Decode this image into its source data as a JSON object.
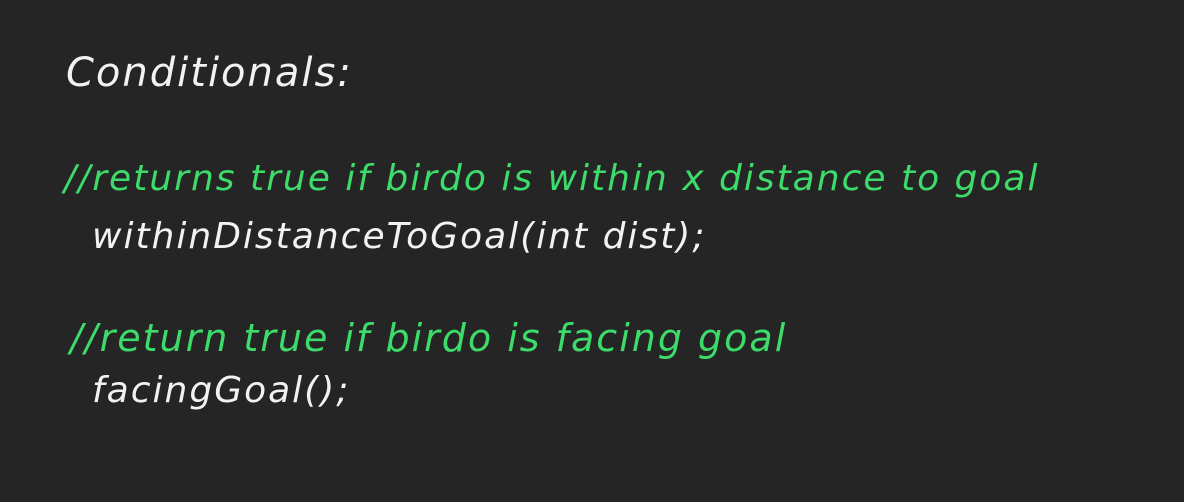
{
  "heading": "Conditionals:",
  "blocks": [
    {
      "comment": "//returns true if birdo is within x distance to goal",
      "code": "withinDistanceToGoal(int dist);"
    },
    {
      "comment": "//return true if birdo is facing goal",
      "code": "facingGoal();"
    }
  ],
  "colors": {
    "background": "#252525",
    "text": "#f2f2f2",
    "comment": "#3ddc6a"
  }
}
